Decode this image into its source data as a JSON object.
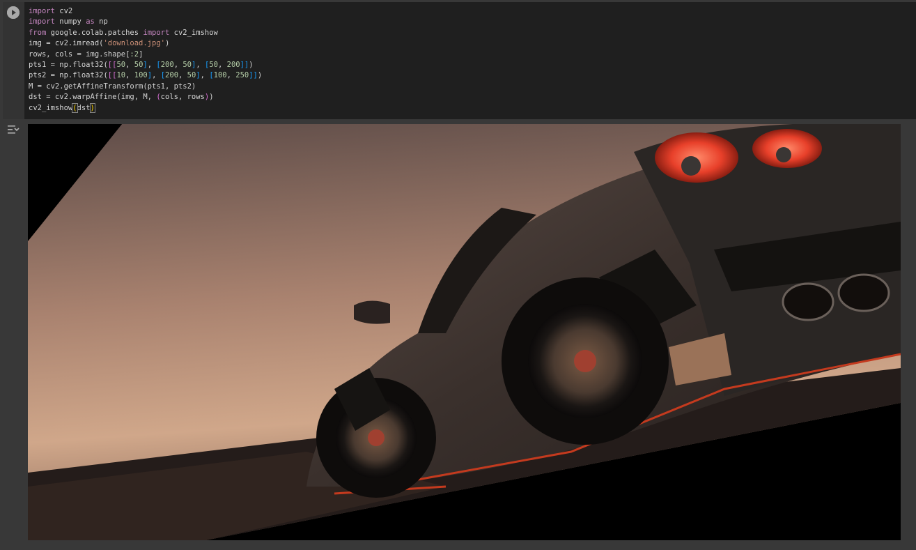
{
  "cell": {
    "code_lines": [
      [
        [
          "kw",
          "import"
        ],
        [
          "p",
          " cv2"
        ]
      ],
      [
        [
          "kw",
          "import"
        ],
        [
          "p",
          " numpy "
        ],
        [
          "kw",
          "as"
        ],
        [
          "p",
          " np"
        ]
      ],
      [
        [
          "kw",
          "from"
        ],
        [
          "p",
          " google.colab.patches "
        ],
        [
          "kw",
          "import"
        ],
        [
          "p",
          " cv2_imshow"
        ]
      ],
      [
        [
          "p",
          "img = cv2.imread("
        ],
        [
          "str",
          "'download.jpg'"
        ],
        [
          "p",
          ")"
        ]
      ],
      [
        [
          "p",
          "rows, cols = img.shape["
        ],
        [
          "num",
          ":2"
        ],
        [
          "p",
          "]"
        ]
      ],
      [
        [
          "p",
          "pts1 = np.float32("
        ],
        [
          "br2",
          "[["
        ],
        [
          "num",
          "50"
        ],
        [
          "p",
          ", "
        ],
        [
          "num",
          "50"
        ],
        [
          "br3",
          "]"
        ],
        [
          "p",
          ", "
        ],
        [
          "br3",
          "["
        ],
        [
          "num",
          "200"
        ],
        [
          "p",
          ", "
        ],
        [
          "num",
          "50"
        ],
        [
          "br3",
          "]"
        ],
        [
          "p",
          ", "
        ],
        [
          "br3",
          "["
        ],
        [
          "num",
          "50"
        ],
        [
          "p",
          ", "
        ],
        [
          "num",
          "200"
        ],
        [
          "br3",
          "]]"
        ],
        [
          "p",
          ")"
        ]
      ],
      [
        [
          "p",
          "pts2 = np.float32("
        ],
        [
          "br2",
          "[["
        ],
        [
          "num",
          "10"
        ],
        [
          "p",
          ", "
        ],
        [
          "num",
          "100"
        ],
        [
          "br3",
          "]"
        ],
        [
          "p",
          ", "
        ],
        [
          "br3",
          "["
        ],
        [
          "num",
          "200"
        ],
        [
          "p",
          ", "
        ],
        [
          "num",
          "50"
        ],
        [
          "br3",
          "]"
        ],
        [
          "p",
          ", "
        ],
        [
          "br3",
          "["
        ],
        [
          "num",
          "100"
        ],
        [
          "p",
          ", "
        ],
        [
          "num",
          "250"
        ],
        [
          "br3",
          "]]"
        ],
        [
          "p",
          ")"
        ]
      ],
      [
        [
          "p",
          "M = cv2.getAffineTransform(pts1, pts2)"
        ]
      ],
      [
        [
          "p",
          "dst = cv2.warpAffine(img, M, "
        ],
        [
          "br2",
          "("
        ],
        [
          "p",
          "cols, rows"
        ],
        [
          "br2",
          ")"
        ],
        [
          "p",
          ")"
        ]
      ],
      [
        [
          "p",
          "cv2_imshow"
        ],
        [
          "cur",
          "("
        ],
        [
          "p",
          "dst"
        ],
        [
          "cur",
          ")"
        ]
      ]
    ],
    "run_icon": "play-icon",
    "output_toggle_icon": "output-toggle-icon"
  },
  "output": {
    "image_description_icon": "warped-image",
    "colors": {
      "sky_top": "#6e5a55",
      "sky_bottom": "#c69c80",
      "car_body": "#3a302c",
      "taillight": "#e8402a",
      "accent_red": "#c43a1e",
      "ground": "#1e1a18"
    }
  }
}
